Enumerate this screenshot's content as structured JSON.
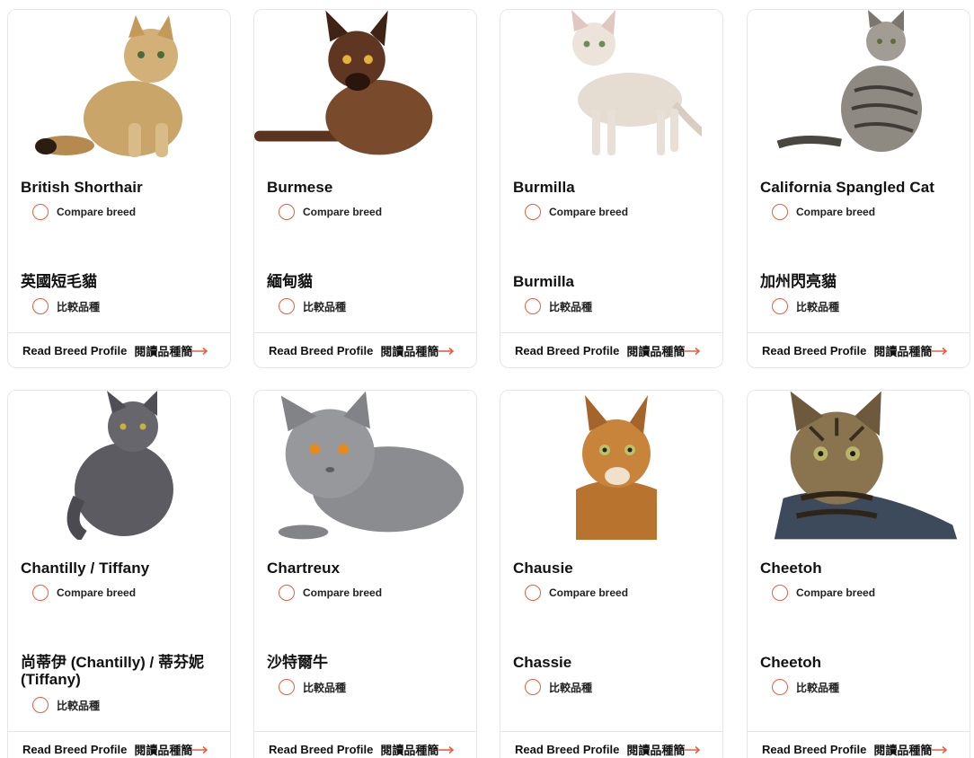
{
  "colors": {
    "accent": "#e85d3f",
    "border": "#e6e6e6"
  },
  "cards": [
    {
      "name_en": "British Shorthair",
      "compare_en": "Compare breed",
      "name_zh": "英國短毛貓",
      "compare_zh": "比較品種",
      "read_en": "Read Breed Profile",
      "read_zh": "閱讀品種簡",
      "photo_icon": "british-shorthair-cat-photo"
    },
    {
      "name_en": "Burmese",
      "compare_en": "Compare breed",
      "name_zh": "緬甸貓",
      "compare_zh": "比較品種",
      "read_en": "Read Breed Profile",
      "read_zh": "閱讀品種簡",
      "photo_icon": "burmese-cat-photo"
    },
    {
      "name_en": "Burmilla",
      "compare_en": "Compare breed",
      "name_zh": "Burmilla",
      "compare_zh": "比較品種",
      "read_en": "Read Breed Profile",
      "read_zh": "閱讀品種簡",
      "photo_icon": "burmilla-cat-photo"
    },
    {
      "name_en": "California Spangled Cat",
      "compare_en": "Compare breed",
      "name_zh": "加州閃亮貓",
      "compare_zh": "比較品種",
      "read_en": "Read Breed Profile",
      "read_zh": "閱讀品種簡",
      "photo_icon": "california-spangled-cat-photo"
    },
    {
      "name_en": "Chantilly / Tiffany",
      "compare_en": "Compare breed",
      "name_zh": "尚蒂伊 (Chantilly) / 蒂芬妮 (Tiffany)",
      "compare_zh": "比較品種",
      "read_en": "Read Breed Profile",
      "read_zh": "閱讀品種簡",
      "photo_icon": "chantilly-tiffany-cat-photo"
    },
    {
      "name_en": "Chartreux",
      "compare_en": "Compare breed",
      "name_zh": "沙特爾牛",
      "compare_zh": "比較品種",
      "read_en": "Read Breed Profile",
      "read_zh": "閱讀品種簡",
      "photo_icon": "chartreux-cat-photo"
    },
    {
      "name_en": "Chausie",
      "compare_en": "Compare breed",
      "name_zh": "Chassie",
      "compare_zh": "比較品種",
      "read_en": "Read Breed Profile",
      "read_zh": "閱讀品種簡",
      "photo_icon": "chausie-cat-photo"
    },
    {
      "name_en": "Cheetoh",
      "compare_en": "Compare breed",
      "name_zh": "Cheetoh",
      "compare_zh": "比較品種",
      "read_en": "Read Breed Profile",
      "read_zh": "閱讀品種簡",
      "photo_icon": "cheetoh-cat-photo"
    }
  ]
}
